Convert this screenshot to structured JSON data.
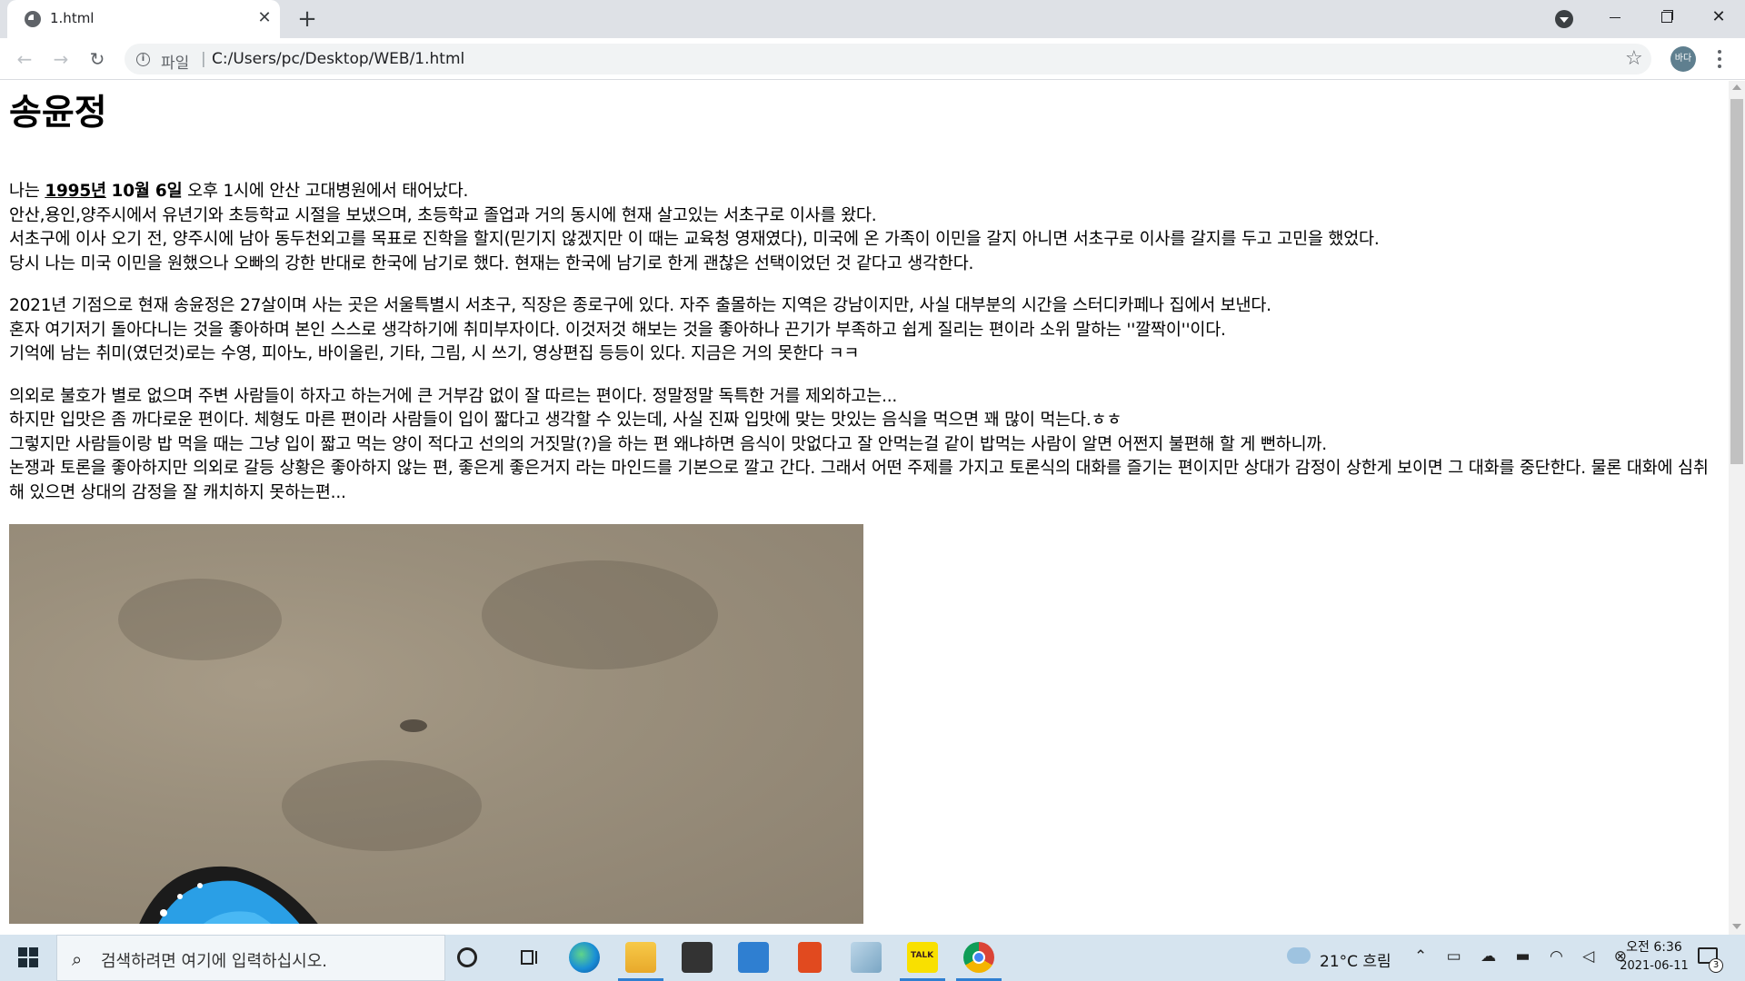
{
  "browser": {
    "tab_title": "1.html",
    "new_tab": "+",
    "omnibox": {
      "scheme_label": "파일",
      "separator": "|",
      "url": "C:/Users/pc/Desktop/WEB/1.html"
    },
    "profile_initials": "바다"
  },
  "page": {
    "heading": "송윤정",
    "p1": {
      "intro_prefix": "나는 ",
      "year": "1995년",
      "space": " ",
      "date": "10월 6일",
      "intro_suffix": " 오후 1시에 안산 고대병원에서 태어났다.",
      "line2": "안산,용인,양주시에서 유년기와 초등학교 시절을 보냈으며, 초등학교 졸업과 거의 동시에 현재 살고있는 서초구로 이사를 왔다.",
      "line3": "서초구에 이사 오기 전, 양주시에 남아 동두천외고를 목표로 진학을 할지(믿기지 않겠지만 이 때는 교육청 영재였다), 미국에 온 가족이 이민을 갈지 아니면 서초구로 이사를 갈지를 두고 고민을 했었다.",
      "line4": "당시 나는 미국 이민을 원했으나 오빠의 강한 반대로 한국에 남기로 했다. 현재는 한국에 남기로 한게 괜찮은 선택이었던 것 같다고 생각한다."
    },
    "p2": {
      "line1": "2021년 기점으로 현재 송윤정은 27살이며 사는 곳은 서울특별시 서초구, 직장은 종로구에 있다. 자주 출몰하는 지역은 강남이지만, 사실 대부분의 시간을 스터디카페나 집에서 보낸다.",
      "line2": "혼자 여기저기 돌아다니는 것을 좋아하며 본인 스스로 생각하기에 취미부자이다. 이것저것 해보는 것을 좋아하나 끈기가 부족하고 쉽게 질리는 편이라 소위 말하는 ''깔짝이''이다.",
      "line3": "기억에 남는 취미(였던것)로는 수영, 피아노, 바이올린, 기타, 그림, 시 쓰기, 영상편집 등등이 있다. 지금은 거의 못한다 ㅋㅋ"
    },
    "p3": {
      "line1": "의외로 불호가 별로 없으며 주변 사람들이 하자고 하는거에 큰 거부감 없이 잘 따르는 편이다. 정말정말 독특한 거를 제외하고는...",
      "line2": "하지만 입맛은 좀 까다로운 편이다. 체형도 마른 편이라 사람들이 입이 짧다고 생각할 수 있는데, 사실 진짜 입맛에 맞는 맛있는 음식을 먹으면 꽤 많이 먹는다.ㅎㅎ",
      "line3": "그렇지만 사람들이랑 밥 먹을 때는 그냥 입이 짧고 먹는 양이 적다고 선의의 거짓말(?)을 하는 편 왜냐하면 음식이 맛없다고 잘 안먹는걸 같이 밥먹는 사람이 알면 어쩐지 불편해 할 게 뻔하니까.",
      "line4": "논쟁과 토론을 좋아하지만 의외로 갈등 상황은 좋아하지 않는 편, 좋은게 좋은거지 라는 마인드를 기본으로 깔고 간다. 그래서 어떤 주제를 가지고 토론식의 대화를 즐기는 편이지만 상대가 감정이 상한게 보이면 그 대화를 중단한다. 물론 대화에 심취해 있으면 상대의 감정을 잘 캐치하지 못하는편..."
    }
  },
  "taskbar": {
    "search_placeholder": "검색하려면 여기에 입력하십시오.",
    "kakao_label": "TALK",
    "weather": "21°C  흐림",
    "time": "오전 6:36",
    "date": "2021-06-11",
    "notification_count": "3"
  }
}
